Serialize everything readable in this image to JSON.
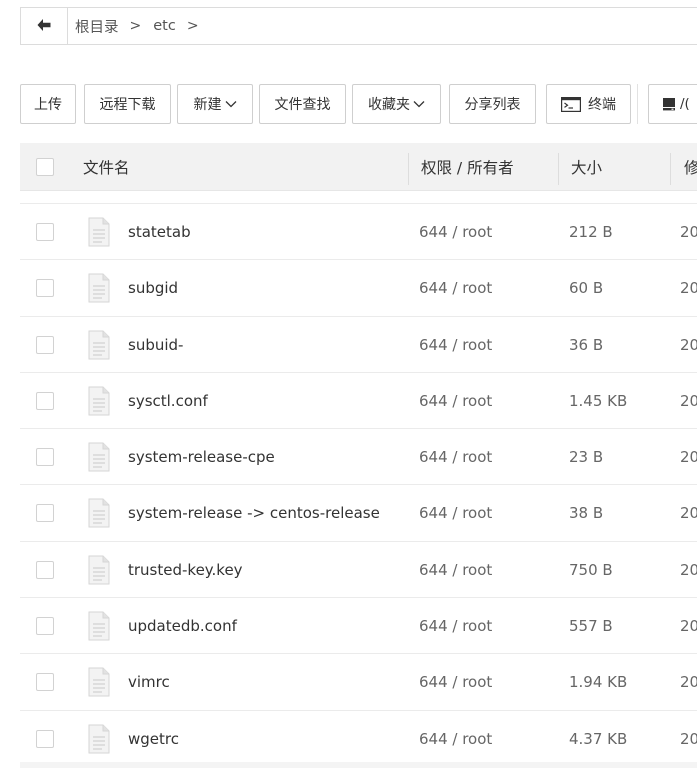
{
  "breadcrumb": {
    "items": [
      "根目录",
      "etc"
    ],
    "separator": ">"
  },
  "toolbar": {
    "upload_label": "上传",
    "remote_download_label": "远程下载",
    "new_label": "新建",
    "find_label": "文件查找",
    "favorites_label": "收藏夹",
    "share_list_label": "分享列表",
    "terminal_label": "终端",
    "disk_label": "/(",
    "caret": "∨"
  },
  "table": {
    "columns": {
      "name": "文件名",
      "perm": "权限 / 所有者",
      "size": "大小",
      "modified": "修"
    },
    "rows": [
      {
        "name": "statetab",
        "perm": "644 / root",
        "size": "212 B",
        "date": "20"
      },
      {
        "name": "subgid",
        "perm": "644 / root",
        "size": "60 B",
        "date": "20"
      },
      {
        "name": "subuid-",
        "perm": "644 / root",
        "size": "36 B",
        "date": "20"
      },
      {
        "name": "sysctl.conf",
        "perm": "644 / root",
        "size": "1.45 KB",
        "date": "20"
      },
      {
        "name": "system-release-cpe",
        "perm": "644 / root",
        "size": "23 B",
        "date": "20"
      },
      {
        "name": "system-release -> centos-release",
        "perm": "644 / root",
        "size": "38 B",
        "date": "20"
      },
      {
        "name": "trusted-key.key",
        "perm": "644 / root",
        "size": "750 B",
        "date": "20"
      },
      {
        "name": "updatedb.conf",
        "perm": "644 / root",
        "size": "557 B",
        "date": "20"
      },
      {
        "name": "vimrc",
        "perm": "644 / root",
        "size": "1.94 KB",
        "date": "20"
      },
      {
        "name": "wgetrc",
        "perm": "644 / root",
        "size": "4.37 KB",
        "date": "20"
      }
    ]
  },
  "icons": {
    "back": "arrow-left-icon",
    "terminal": "terminal-icon",
    "disk": "disk-icon",
    "file": "file-icon"
  },
  "colors": {
    "border": "#cfcfcf",
    "header_bg": "#f2f2f2",
    "text": "#333333",
    "muted_text": "#666666",
    "file_icon": "#d8d8d8"
  }
}
